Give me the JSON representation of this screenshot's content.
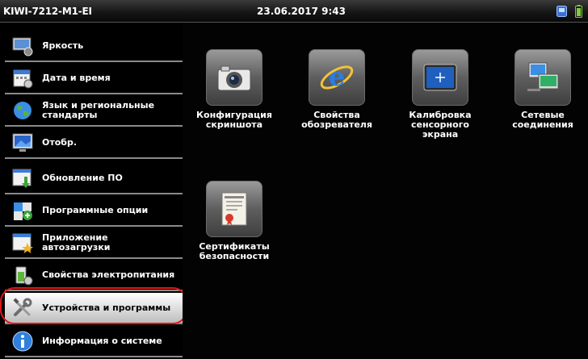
{
  "statusbar": {
    "device_name": "KIWI-7212-M1-EI",
    "datetime": "23.06.2017 9:43",
    "network_icon": "network-icon",
    "battery_icon": "battery-icon"
  },
  "sidebar": {
    "items": [
      {
        "label": "Яркость",
        "icon": "brightness-icon",
        "active": false
      },
      {
        "label": "Дата и время",
        "icon": "calendar-icon",
        "active": false
      },
      {
        "label": "Язык и региональные стандарты",
        "icon": "globe-icon",
        "active": false
      },
      {
        "label": "Отобр.",
        "icon": "display-icon",
        "active": false
      },
      {
        "label": "Обновление ПО",
        "icon": "update-icon",
        "active": false
      },
      {
        "label": "Программные опции",
        "icon": "puzzle-icon",
        "active": false
      },
      {
        "label": "Приложение автозагрузки",
        "icon": "startup-star-icon",
        "active": false
      },
      {
        "label": "Свойства электропитания",
        "icon": "power-icon",
        "active": false
      },
      {
        "label": "Устройства и программы",
        "icon": "tools-icon",
        "active": true
      },
      {
        "label": "Информация о системе",
        "icon": "info-icon",
        "active": false
      }
    ],
    "highlight_color": "#e01818"
  },
  "main": {
    "tiles": [
      {
        "label": "Конфигурация скриншота",
        "icon": "camera-icon"
      },
      {
        "label": "Свойства обозревателя",
        "icon": "internet-explorer-icon"
      },
      {
        "label": "Калибровка сенсорного экрана",
        "icon": "touch-calibration-icon"
      },
      {
        "label": "Сетевые соединения",
        "icon": "network-connections-icon"
      },
      {
        "label": "Сертификаты безопасности",
        "icon": "certificate-icon"
      }
    ]
  }
}
